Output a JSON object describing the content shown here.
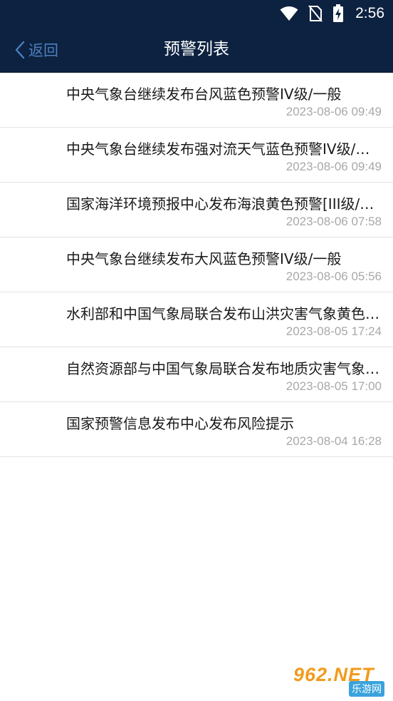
{
  "status_bar": {
    "time": "2:56"
  },
  "header": {
    "back_label": "返回",
    "title": "预警列表"
  },
  "warnings": [
    {
      "title": "中央气象台继续发布台风蓝色预警IV级/一般",
      "time": "2023-08-06 09:49"
    },
    {
      "title": "中央气象台继续发布强对流天气蓝色预警IV级/一般",
      "time": "2023-08-06 09:49"
    },
    {
      "title": "国家海洋环境预报中心发布海浪黄色预警[III级/较重]",
      "time": "2023-08-06 07:58"
    },
    {
      "title": "中央气象台继续发布大风蓝色预警IV级/一般",
      "time": "2023-08-06 05:56"
    },
    {
      "title": "水利部和中国气象局联合发布山洪灾害气象黄色预警",
      "time": "2023-08-05 17:24"
    },
    {
      "title": "自然资源部与中国气象局联合发布地质灾害气象风险预警",
      "time": "2023-08-05 17:00"
    },
    {
      "title": "国家预警信息发布中心发布风险提示",
      "time": "2023-08-04 16:28"
    }
  ],
  "watermark": {
    "main": "962.NET",
    "sub": "乐游网"
  },
  "colors": {
    "header_bg": "#0d2240",
    "back_accent": "#4a7fc0",
    "timestamp": "#a8a8a8",
    "divider": "#e4e4e4"
  }
}
